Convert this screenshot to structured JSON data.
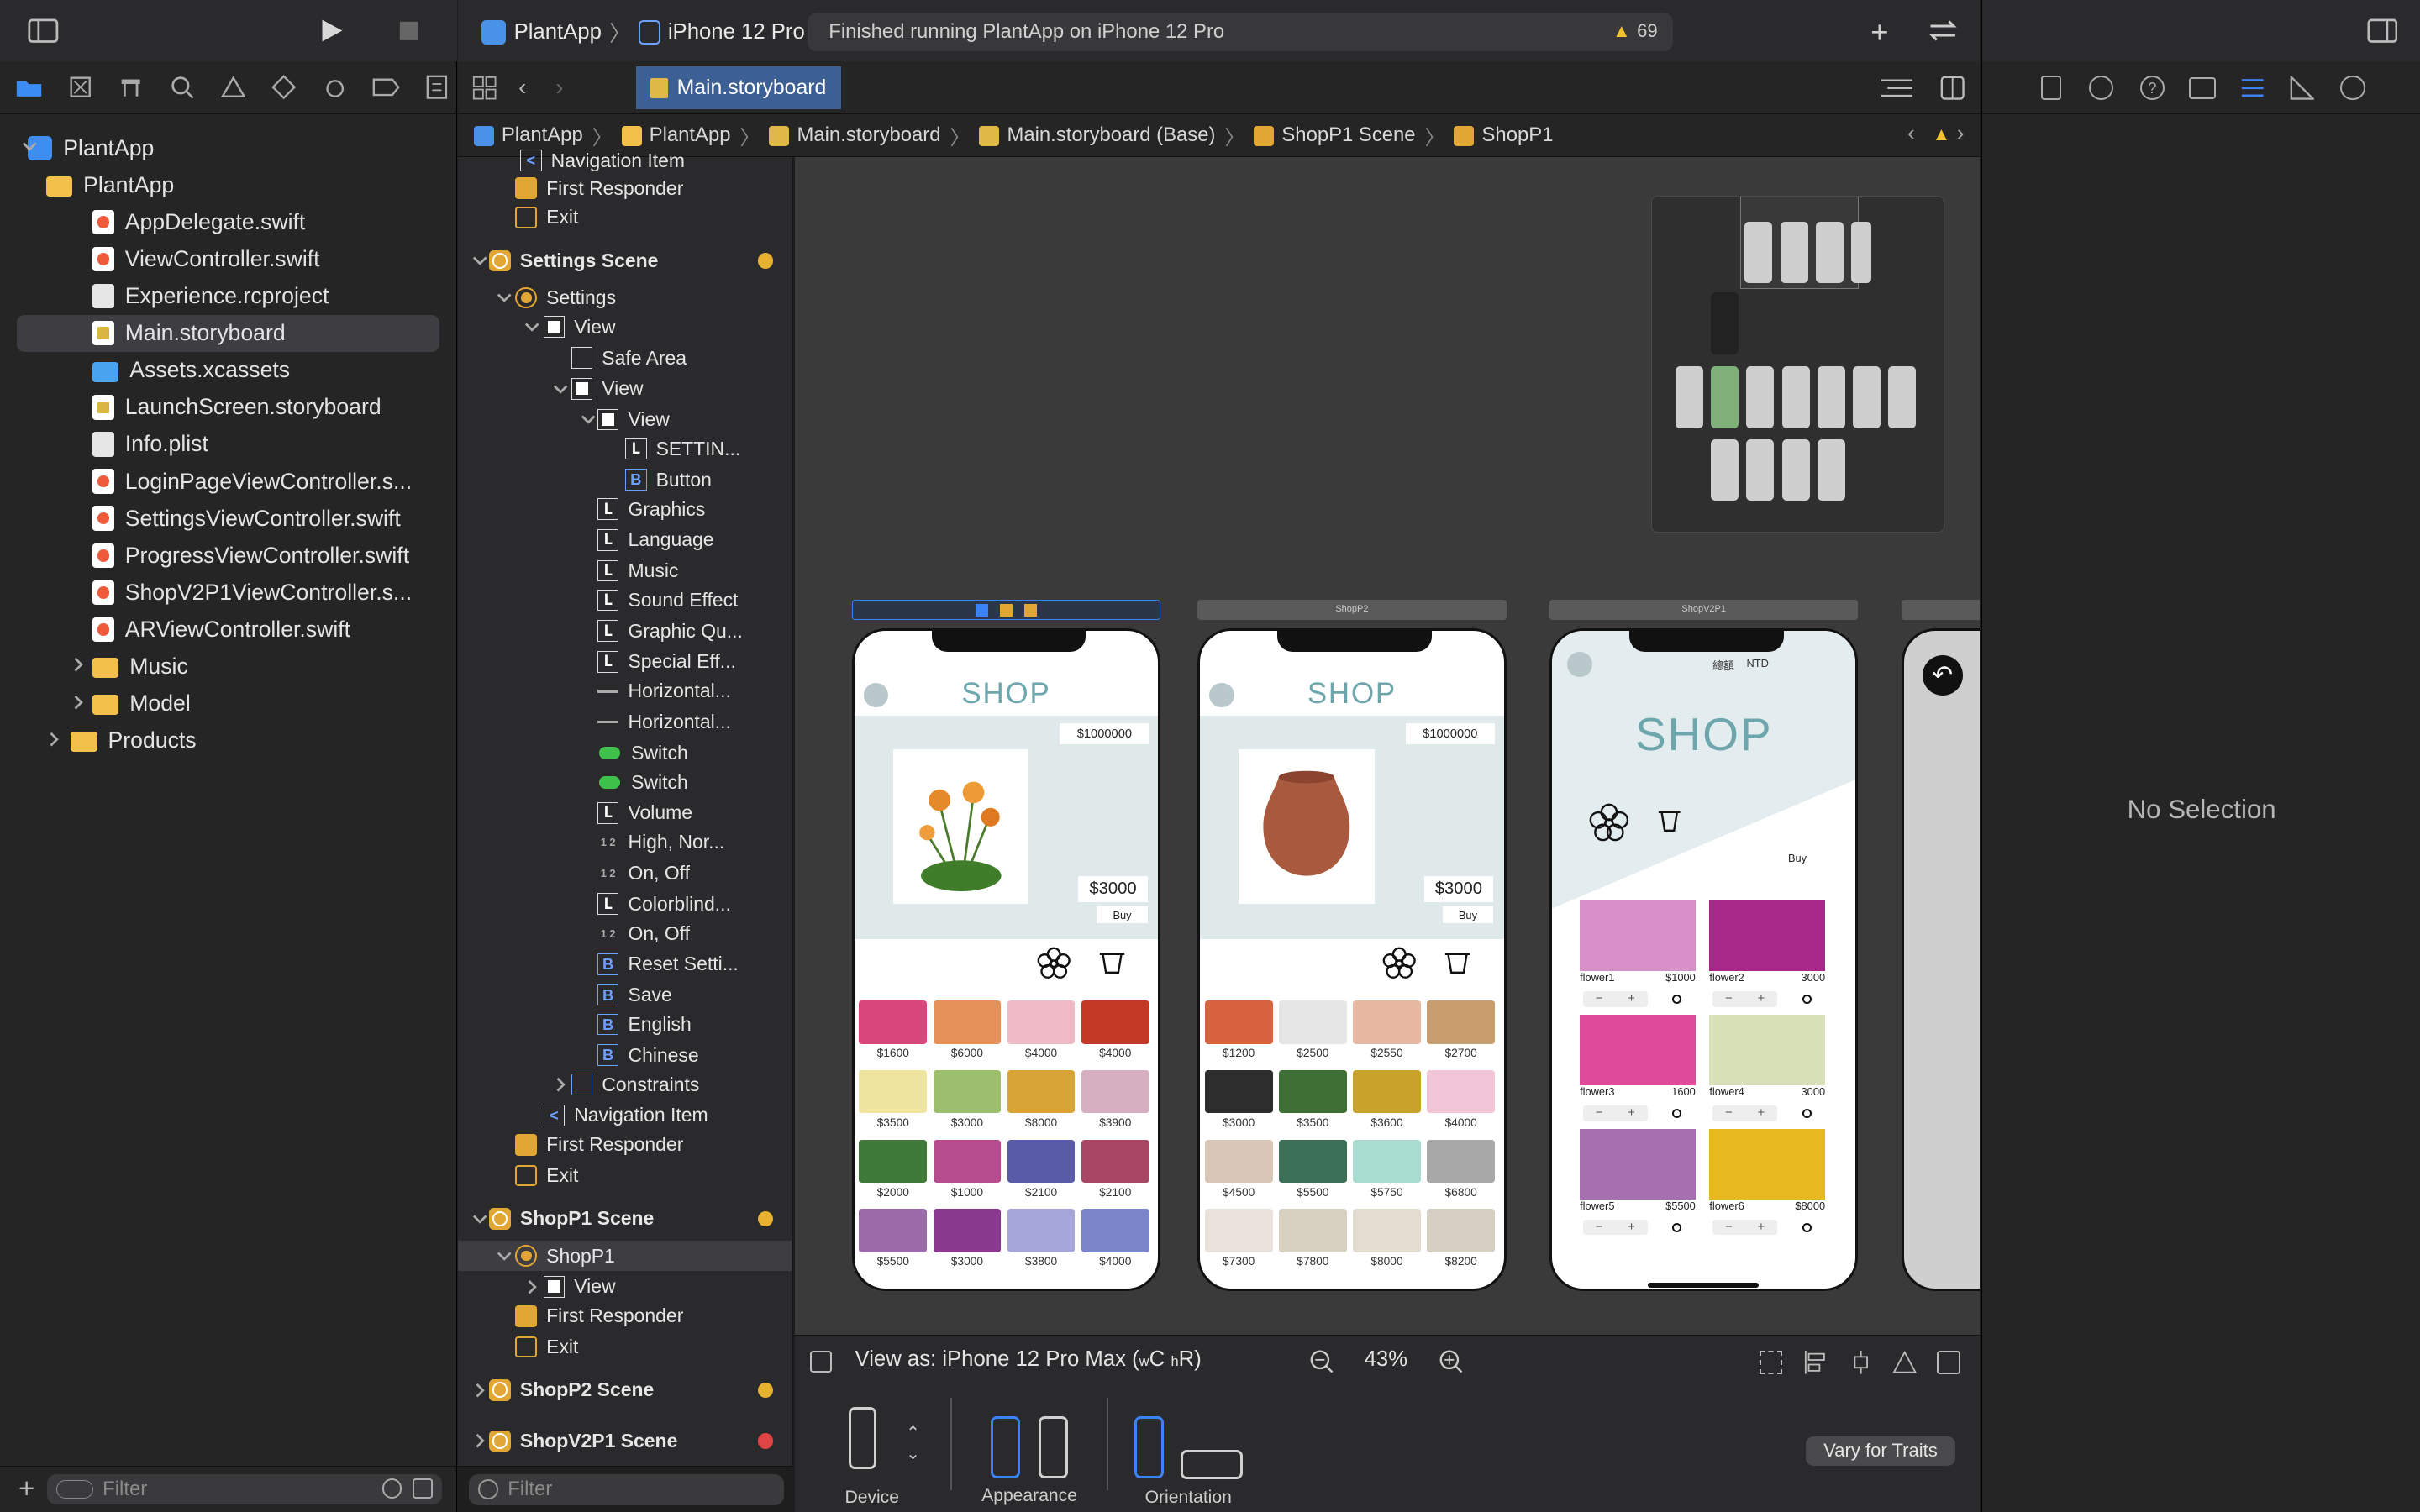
{
  "toolbar": {
    "scheme": "PlantApp",
    "device": "iPhone 12 Pro",
    "status": "Finished running PlantApp on iPhone 12 Pro",
    "warnings": "69"
  },
  "editor_tab": {
    "label": "Main.storyboard"
  },
  "jumpbar": [
    "PlantApp",
    "PlantApp",
    "Main.storyboard",
    "Main.storyboard (Base)",
    "ShopP1 Scene",
    "ShopP1"
  ],
  "navigator": {
    "items": [
      {
        "label": "PlantApp",
        "kind": "proj"
      },
      {
        "label": "PlantApp",
        "kind": "folder"
      },
      {
        "label": "AppDelegate.swift",
        "kind": "sw"
      },
      {
        "label": "ViewController.swift",
        "kind": "sw"
      },
      {
        "label": "Experience.rcproject",
        "kind": "plist"
      },
      {
        "label": "Main.storyboard",
        "kind": "doc"
      },
      {
        "label": "Assets.xcassets",
        "kind": "folderblue"
      },
      {
        "label": "LaunchScreen.storyboard",
        "kind": "doc"
      },
      {
        "label": "Info.plist",
        "kind": "plist"
      },
      {
        "label": "LoginPageViewController.s...",
        "kind": "sw"
      },
      {
        "label": "SettingsViewController.swift",
        "kind": "sw"
      },
      {
        "label": "ProgressViewController.swift",
        "kind": "sw"
      },
      {
        "label": "ShopV2P1ViewController.s...",
        "kind": "sw"
      },
      {
        "label": "ARViewController.swift",
        "kind": "sw"
      },
      {
        "label": "Music",
        "kind": "folder"
      },
      {
        "label": "Model",
        "kind": "folder"
      },
      {
        "label": "Products",
        "kind": "folder"
      }
    ],
    "filter_placeholder": "Filter"
  },
  "outline": {
    "rows": [
      {
        "label": "Navigation Item",
        "icon": "ni"
      },
      {
        "label": "First Responder",
        "icon": "fr"
      },
      {
        "label": "Exit",
        "icon": "ex"
      },
      {
        "label": "Settings Scene",
        "icon": "sc"
      },
      {
        "label": "Settings",
        "icon": "vc"
      },
      {
        "label": "View",
        "icon": "V"
      },
      {
        "label": "Safe Area",
        "icon": "sa"
      },
      {
        "label": "View",
        "icon": "V"
      },
      {
        "label": "View",
        "icon": "V"
      },
      {
        "label": "SETTIN...",
        "icon": "L"
      },
      {
        "label": "Button",
        "icon": "B"
      },
      {
        "label": "Graphics",
        "icon": "L"
      },
      {
        "label": "Language",
        "icon": "L"
      },
      {
        "label": "Music",
        "icon": "L"
      },
      {
        "label": "Sound Effect",
        "icon": "L"
      },
      {
        "label": "Graphic Qu...",
        "icon": "L"
      },
      {
        "label": "Special Eff...",
        "icon": "L"
      },
      {
        "label": "Horizontal...",
        "icon": "sl"
      },
      {
        "label": "Horizontal...",
        "icon": "sl"
      },
      {
        "label": "Switch",
        "icon": "sw"
      },
      {
        "label": "Switch",
        "icon": "sw"
      },
      {
        "label": "Volume",
        "icon": "L"
      },
      {
        "label": "High, Nor...",
        "icon": "seg"
      },
      {
        "label": "On, Off",
        "icon": "seg"
      },
      {
        "label": "Colorblind...",
        "icon": "L"
      },
      {
        "label": "On, Off",
        "icon": "seg"
      },
      {
        "label": "Reset Setti...",
        "icon": "B"
      },
      {
        "label": "Save",
        "icon": "B"
      },
      {
        "label": "English",
        "icon": "B"
      },
      {
        "label": "Chinese",
        "icon": "B"
      },
      {
        "label": "Constraints",
        "icon": "cn"
      },
      {
        "label": "Navigation Item",
        "icon": "ni"
      },
      {
        "label": "First Responder",
        "icon": "fr"
      },
      {
        "label": "Exit",
        "icon": "ex"
      },
      {
        "label": "ShopP1 Scene",
        "icon": "sc"
      },
      {
        "label": "ShopP1",
        "icon": "vc"
      },
      {
        "label": "View",
        "icon": "V"
      },
      {
        "label": "First Responder",
        "icon": "fr"
      },
      {
        "label": "Exit",
        "icon": "ex"
      },
      {
        "label": "ShopP2 Scene",
        "icon": "sc"
      },
      {
        "label": "ShopV2P1 Scene",
        "icon": "sc"
      }
    ],
    "filter_placeholder": "Filter"
  },
  "canvas": {
    "scene_labels": [
      "ShopP2",
      "ShopV2P1"
    ],
    "shop1": {
      "title": "SHOP",
      "balance": "$1000000",
      "price": "$3000",
      "buy": "Buy",
      "prices": [
        "$1600",
        "$6000",
        "$4000",
        "$4000",
        "$3500",
        "$3000",
        "$8000",
        "$3900",
        "$2000",
        "$1000",
        "$2100",
        "$2100",
        "$5500",
        "$3000",
        "$3800",
        "$4000"
      ]
    },
    "shop2": {
      "title": "SHOP",
      "balance": "$1000000",
      "price": "$3000",
      "buy": "Buy",
      "prices": [
        "$1200",
        "$2500",
        "$2550",
        "$2700",
        "$3000",
        "$3500",
        "$3600",
        "$4000",
        "$4500",
        "$5500",
        "$5750",
        "$6800",
        "$7300",
        "$7800",
        "$8000",
        "$8200"
      ]
    },
    "shop3": {
      "title": "SHOP",
      "balance_label": "總額",
      "currency": "NTD",
      "buy": "Buy",
      "items": [
        {
          "name": "flower1",
          "price": "$1000"
        },
        {
          "name": "flower2",
          "price": "3000"
        },
        {
          "name": "flower3",
          "price": "1600"
        },
        {
          "name": "flower4",
          "price": "3000"
        },
        {
          "name": "flower5",
          "price": "$5500"
        },
        {
          "name": "flower6",
          "price": "$8000"
        }
      ]
    }
  },
  "canvas_bar": {
    "view_as": "View as: iPhone 12 Pro Max (",
    "w": "w",
    "c": "C",
    "h": "h",
    "r": "R)",
    "zoom": "43%"
  },
  "traits": {
    "device": "Device",
    "appearance": "Appearance",
    "orientation": "Orientation",
    "vary": "Vary for Traits"
  },
  "inspector": {
    "empty": "No Selection"
  },
  "colors": {
    "accent": "#3c5f96",
    "shop_title": "#6da6ac",
    "hero_bg": "#e0e9ea"
  }
}
